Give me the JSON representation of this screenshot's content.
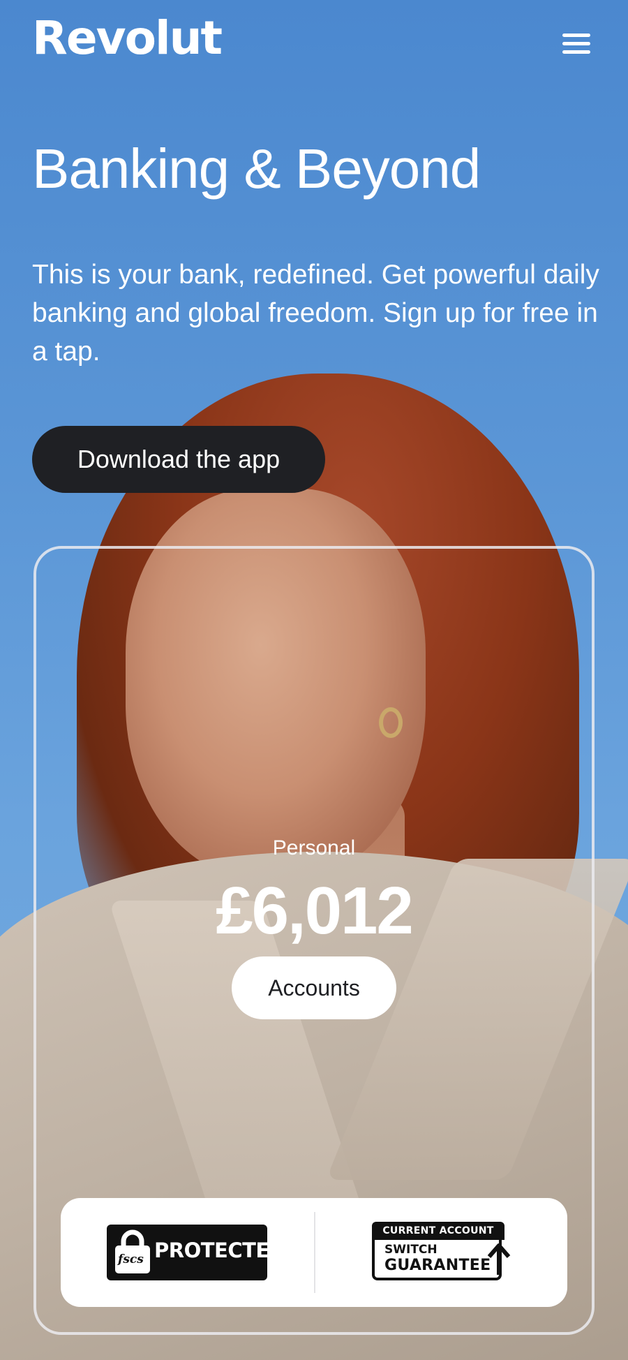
{
  "header": {
    "logo": "Revolut",
    "menu_icon": "hamburger-menu-icon"
  },
  "hero": {
    "headline": "Banking & Beyond",
    "subtitle": "This is your bank, redefined. Get powerful daily banking and global freedom. Sign up for free in a tap.",
    "cta_label": "Download the app",
    "background_color": "#5b96d6"
  },
  "card": {
    "account_type": "Personal",
    "balance": "£6,012",
    "accounts_label": "Accounts"
  },
  "badges": {
    "fscs": {
      "logo_text": "fscs",
      "label": "PROTECTED"
    },
    "switch_guarantee": {
      "top": "CURRENT ACCOUNT",
      "line1": "SWITCH",
      "line2": "GUARANTEE"
    }
  },
  "colors": {
    "button_dark": "#1f2024",
    "text_light": "#ffffff"
  }
}
